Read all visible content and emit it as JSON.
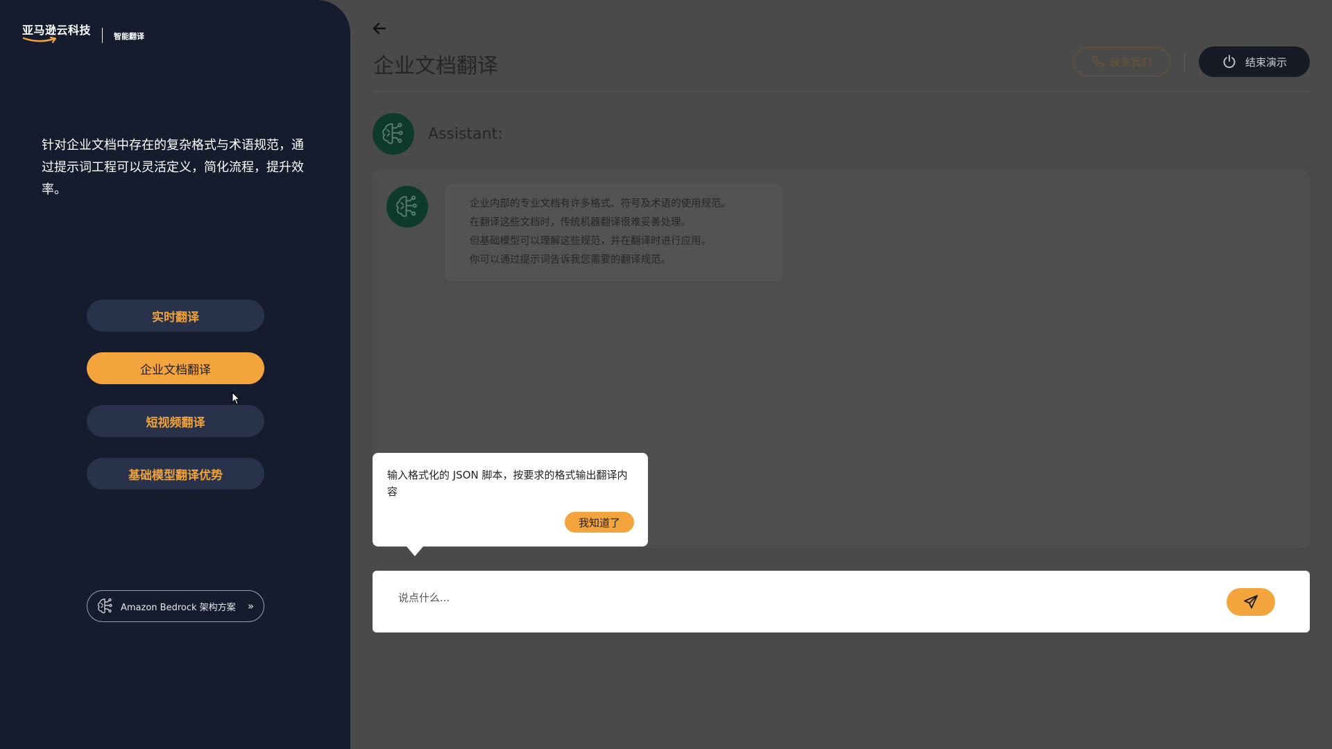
{
  "brand": {
    "name": "亚马逊云科技",
    "subtitle": "智能翻译"
  },
  "sidebar": {
    "intro": "针对企业文档中存在的复杂格式与术语规范，通过提示词工程可以灵活定义，简化流程，提升效率。",
    "nav": [
      {
        "label": "实时翻译"
      },
      {
        "label": "企业文档翻译"
      },
      {
        "label": "短视频翻译"
      },
      {
        "label": "基础模型翻译优势"
      }
    ],
    "bedrock_label": "Amazon Bedrock 架构方案"
  },
  "header": {
    "title": "企业文档翻译",
    "contact_label": "联系我们",
    "end_label": "结束演示"
  },
  "assistant": {
    "name": "Assistant:"
  },
  "message": {
    "lines": [
      "企业内部的专业文档有许多格式、符号及术语的使用规范。",
      "在翻译这些文档时，传统机器翻译很难妥善处理。",
      "但基础模型可以理解这些规范，并在翻译时进行应用。",
      "你可以通过提示词告诉我您需要的翻译规范。"
    ]
  },
  "tooltip": {
    "text": "输入格式化的 JSON 脚本，按要求的格式输出翻译内容",
    "button": "我知道了"
  },
  "input": {
    "placeholder": "说点什么..."
  },
  "colors": {
    "accent": "#f3a43c",
    "sidebar_bg": "#151c2d",
    "nav_bg": "#28324a",
    "overlay_bg": "#4a4a4a",
    "avatar_bg": "#0d3a2c"
  },
  "icons": {
    "back": "arrow-left-icon",
    "contact": "phone-icon",
    "end": "power-icon",
    "avatar": "brain-circuit-icon",
    "send": "paper-plane-icon",
    "bedrock": "brain-circuit-icon",
    "bedrock_chevron": "double-chevron-right-icon"
  }
}
